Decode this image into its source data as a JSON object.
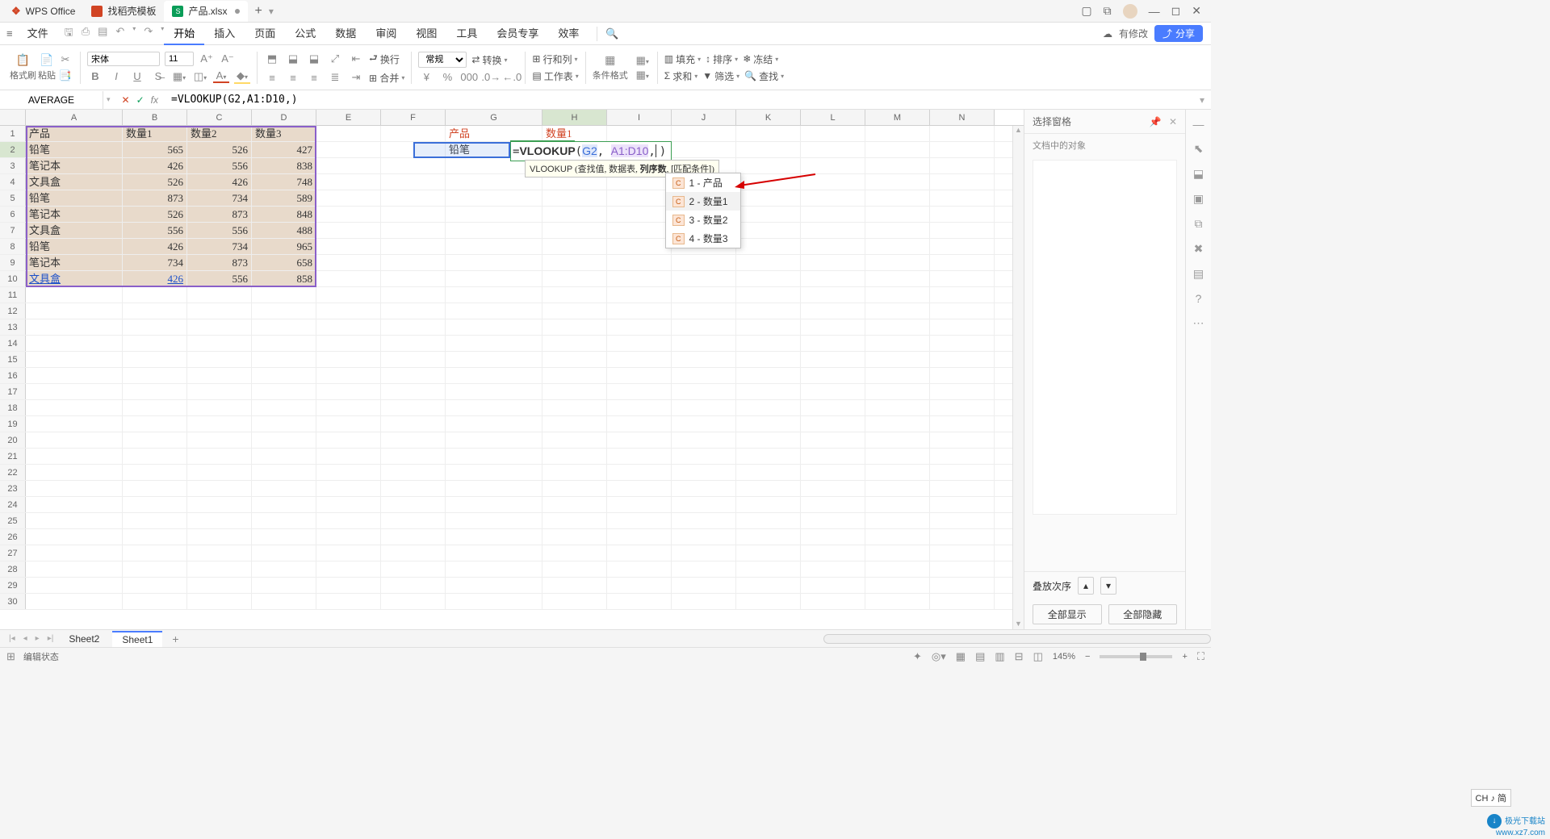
{
  "titlebar": {
    "app": "WPS Office",
    "tab1": "找稻壳模板",
    "tab2": "产品.xlsx"
  },
  "menubar": {
    "file": "文件",
    "items": [
      "开始",
      "插入",
      "页面",
      "公式",
      "数据",
      "审阅",
      "视图",
      "工具",
      "会员专享",
      "效率"
    ],
    "changes": "有修改",
    "share": "分享"
  },
  "ribbon": {
    "format_brush": "格式刷",
    "paste": "粘贴",
    "font_name": "宋体",
    "font_size": "11",
    "wrap": "换行",
    "general": "常规",
    "convert": "转换",
    "rowcol": "行和列",
    "worksheet": "工作表",
    "cond_fmt": "条件格式",
    "fill": "填充",
    "sort": "排序",
    "freeze": "冻结",
    "sum": "求和",
    "filter": "筛选",
    "find": "查找"
  },
  "fx": {
    "namebox": "AVERAGE",
    "formula": "=VLOOKUP(G2,A1:D10,)"
  },
  "cols": [
    "A",
    "B",
    "C",
    "D",
    "E",
    "F",
    "G",
    "H",
    "I",
    "J",
    "K",
    "L",
    "M",
    "N"
  ],
  "table": {
    "headers": [
      "产品",
      "数量1",
      "数量2",
      "数量3"
    ],
    "rows": [
      [
        "铅笔",
        "565",
        "526",
        "427"
      ],
      [
        "笔记本",
        "426",
        "556",
        "838"
      ],
      [
        "文具盒",
        "526",
        "426",
        "748"
      ],
      [
        "铅笔",
        "873",
        "734",
        "589"
      ],
      [
        "笔记本",
        "526",
        "873",
        "848"
      ],
      [
        "文具盒",
        "556",
        "556",
        "488"
      ],
      [
        "铅笔",
        "426",
        "734",
        "965"
      ],
      [
        "笔记本",
        "734",
        "873",
        "658"
      ],
      [
        "文具盒",
        "426",
        "556",
        "858"
      ]
    ]
  },
  "side": {
    "g1": "产品",
    "h1": "数量1",
    "g2": "铅笔"
  },
  "cell_edit": {
    "fn": "VLOOKUP",
    "ref1": "G2",
    "ref2": "A1:D10"
  },
  "hint": {
    "fn": "VLOOKUP",
    "p1": "查找值",
    "p2": "数据表",
    "p3": "列序数",
    "p4": "[匹配条件]"
  },
  "autocomplete": {
    "items": [
      "1 - 产品",
      "2 - 数量1",
      "3 - 数量2",
      "4 - 数量3"
    ]
  },
  "rpane": {
    "title": "选择窗格",
    "sub": "文档中的对象",
    "order": "叠放次序",
    "show_all": "全部显示",
    "hide_all": "全部隐藏"
  },
  "sheets": {
    "s1": "Sheet2",
    "s2": "Sheet1"
  },
  "status": {
    "mode": "编辑状态",
    "zoom": "145%"
  },
  "ime": "CH ♪ 简",
  "watermark": {
    "l1": "极光下载站",
    "l2": "www.xz7.com"
  }
}
